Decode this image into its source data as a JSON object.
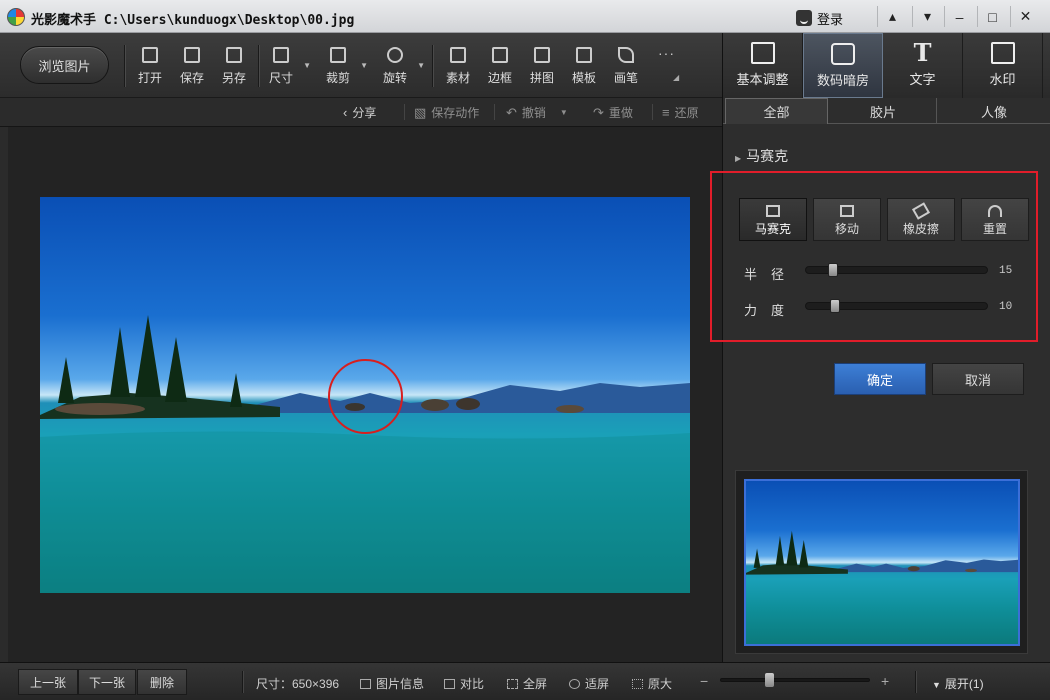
{
  "window": {
    "title": "光影魔术手  C:\\Users\\kunduogx\\Desktop\\00.jpg",
    "login_label": "登录",
    "controls": [
      "skin-icon",
      "menu-icon",
      "minimize-icon",
      "maximize-icon",
      "close-icon"
    ]
  },
  "toolbar": {
    "browse_label": "浏览图片",
    "tools": [
      {
        "label": "打开",
        "icon": "open-icon"
      },
      {
        "label": "保存",
        "icon": "save-icon"
      },
      {
        "label": "另存",
        "icon": "save-as-icon"
      },
      {
        "label": "尺寸",
        "icon": "resize-icon",
        "dropdown": true
      },
      {
        "label": "裁剪",
        "icon": "crop-icon",
        "dropdown": true
      },
      {
        "label": "旋转",
        "icon": "rotate-icon",
        "dropdown": true
      },
      {
        "label": "素材",
        "icon": "material-icon"
      },
      {
        "label": "边框",
        "icon": "border-icon"
      },
      {
        "label": "拼图",
        "icon": "collage-icon"
      },
      {
        "label": "模板",
        "icon": "template-icon"
      },
      {
        "label": "画笔",
        "icon": "brush-icon"
      }
    ],
    "more_label": "···"
  },
  "modes": [
    {
      "label": "基本调整",
      "icon": "basic-adjust-icon",
      "active": false
    },
    {
      "label": "数码暗房",
      "icon": "darkroom-icon",
      "active": true
    },
    {
      "label": "文字",
      "icon": "text-icon",
      "active": false
    },
    {
      "label": "水印",
      "icon": "watermark-icon",
      "active": false
    }
  ],
  "actions": [
    {
      "label": "分享",
      "icon": "share-icon",
      "enabled": true
    },
    {
      "label": "保存动作",
      "icon": "save-action-icon",
      "enabled": false
    },
    {
      "label": "撤销",
      "icon": "undo-icon",
      "enabled": false
    },
    {
      "label": "重做",
      "icon": "redo-icon",
      "enabled": false
    },
    {
      "label": "还原",
      "icon": "restore-icon",
      "enabled": false
    }
  ],
  "panel": {
    "tabs": [
      "全部",
      "胶片",
      "人像"
    ],
    "section_title": "马赛克",
    "mosaic_buttons": [
      {
        "label": "马赛克",
        "icon": "mosaic-icon",
        "active": true
      },
      {
        "label": "移动",
        "icon": "move-icon",
        "active": false
      },
      {
        "label": "橡皮擦",
        "icon": "eraser-icon",
        "active": false
      },
      {
        "label": "重置",
        "icon": "reset-icon",
        "active": false
      }
    ],
    "sliders": [
      {
        "label": "半径",
        "value": "15",
        "fraction": 0.15
      },
      {
        "label": "力度",
        "value": "10",
        "fraction": 0.16
      }
    ],
    "ok_label": "确定",
    "cancel_label": "取消"
  },
  "statusbar": {
    "prev_label": "上一张",
    "next_label": "下一张",
    "delete_label": "删除",
    "size_text": "尺寸：650×396",
    "items": [
      {
        "label": "图片信息",
        "icon": "image-info-icon"
      },
      {
        "label": "对比",
        "icon": "compare-icon"
      },
      {
        "label": "全屏",
        "icon": "fullscreen-icon"
      },
      {
        "label": "适屏",
        "icon": "fit-screen-icon"
      },
      {
        "label": "原大",
        "icon": "actual-size-icon"
      }
    ],
    "zoom_fraction": 0.32,
    "expand_label": "展开(1)"
  },
  "colors": {
    "accent": "#2a5fb0",
    "highlight": "#e11d2a",
    "annotation_circle": "#d81e1e"
  }
}
